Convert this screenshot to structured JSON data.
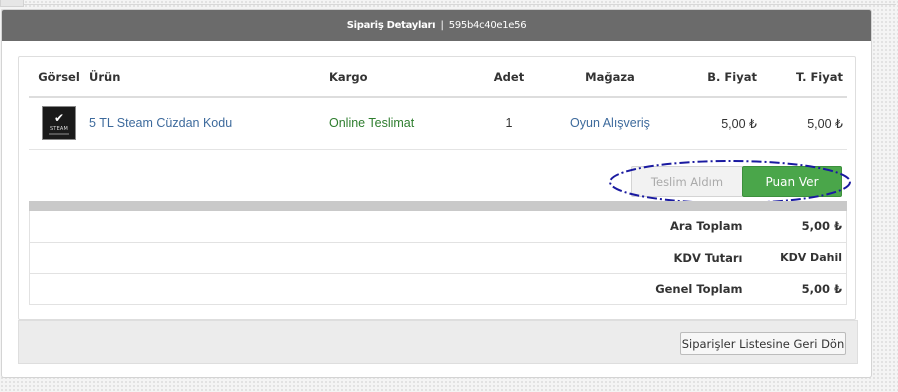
{
  "header": {
    "title": "Sipariş Detayları",
    "separator": "|",
    "order_id": "595b4c40e1e56"
  },
  "table": {
    "columns": {
      "image": "Görsel",
      "product": "Ürün",
      "cargo": "Kargo",
      "quantity": "Adet",
      "store": "Mağaza",
      "unit_price": "B. Fiyat",
      "total_price": "T. Fiyat"
    },
    "rows": [
      {
        "thumbnail_icon": "steam-wallet-thumbnail",
        "thumbnail_text": "STEAM",
        "product": "5 TL Steam Cüzdan Kodu",
        "cargo": "Online Teslimat",
        "quantity": "1",
        "store": "Oyun Alışveriş",
        "unit_price": "5,00 ₺",
        "total_price": "5,00 ₺"
      }
    ]
  },
  "actions": {
    "received_label": "Teslim Aldım",
    "rate_label": "Puan Ver"
  },
  "totals": {
    "subtotal_label": "Ara Toplam",
    "subtotal_value": "5,00 ₺",
    "vat_label": "KDV Tutarı",
    "vat_value": "KDV Dahil",
    "grand_total_label": "Genel Toplam",
    "grand_total_value": "5,00 ₺"
  },
  "footer": {
    "back_label": "Siparişler Listesine Geri Dön"
  },
  "colors": {
    "header_bg": "#6b6b6b",
    "link": "#3d6a9c",
    "cargo": "#2e7d2e",
    "rate_button": "#4aa64a",
    "highlight": "#1a1aa0"
  }
}
